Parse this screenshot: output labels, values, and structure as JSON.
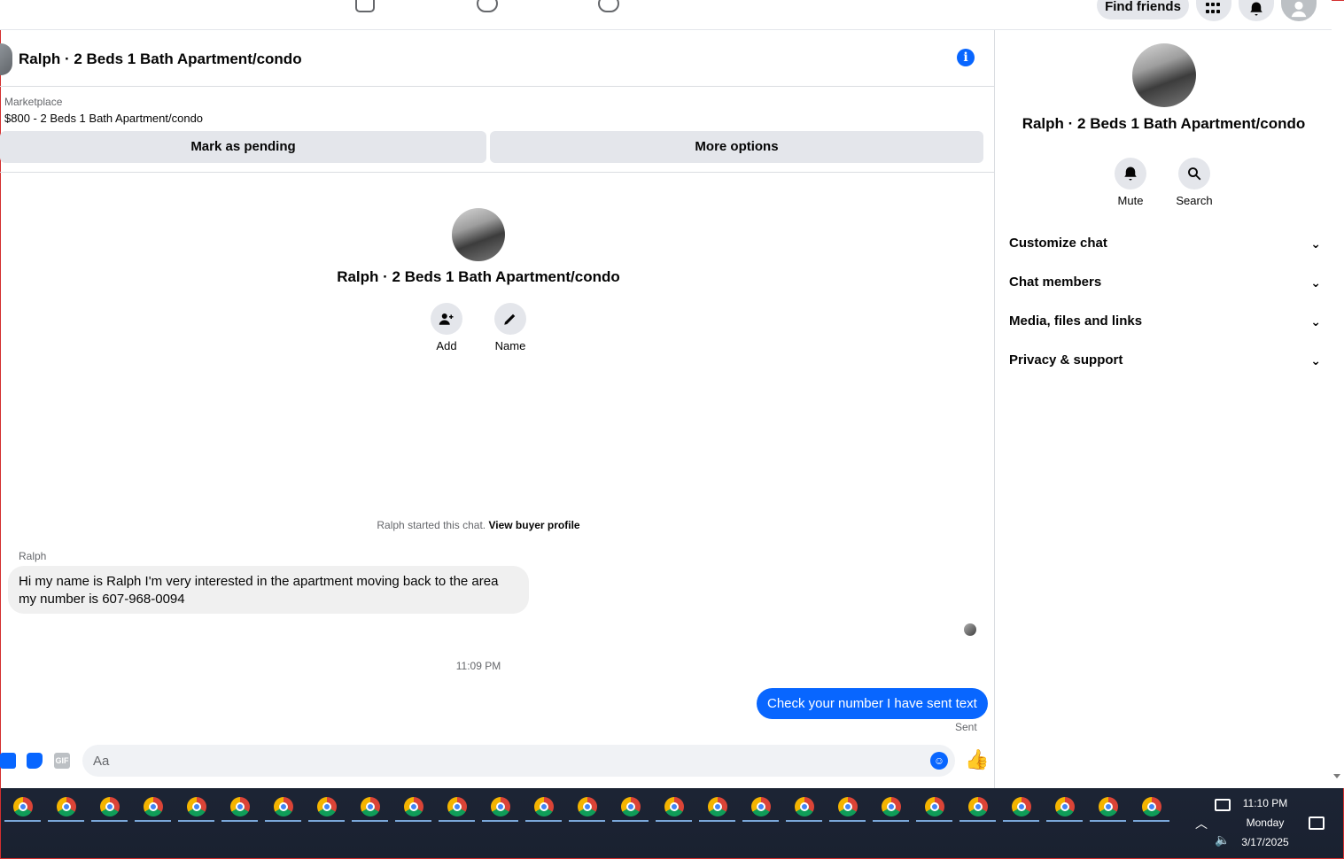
{
  "topnav": {
    "find_friends": "Find friends"
  },
  "chat": {
    "title": "Ralph · 2 Beds 1 Bath Apartment/condo",
    "marketplace_label": "Marketplace",
    "listing": "$800 - 2 Beds 1 Bath Apartment/condo",
    "mark_pending": "Mark as pending",
    "more_options": "More options",
    "profile_title": "Ralph · 2 Beds 1 Bath Apartment/condo",
    "actions": [
      {
        "label": "Add",
        "icon": "add-person-icon"
      },
      {
        "label": "Name",
        "icon": "pencil-icon"
      }
    ],
    "started_text": "Ralph started this chat.",
    "view_buyer_profile": "View buyer profile",
    "messages": [
      {
        "sender": "Ralph",
        "text": "Hi my name is Ralph I'm very interested in the apartment moving back to the area my number is 607-968-0094",
        "direction": "in"
      },
      {
        "timestamp": "11:09 PM"
      },
      {
        "text": "Check your number I have sent text",
        "direction": "out",
        "status": "Sent"
      }
    ],
    "composer_placeholder": "Aa",
    "gif_label": "GIF"
  },
  "right_panel": {
    "title": "Ralph · 2 Beds 1 Bath Apartment/condo",
    "actions": [
      {
        "label": "Mute",
        "icon": "bell-icon"
      },
      {
        "label": "Search",
        "icon": "search-icon"
      }
    ],
    "sections": [
      "Customize chat",
      "Chat members",
      "Media, files and links",
      "Privacy & support"
    ]
  },
  "taskbar": {
    "app_count": 27,
    "time": "11:10 PM",
    "day": "Monday",
    "date": "3/17/2025"
  },
  "colors": {
    "accent": "#0866ff",
    "button_bg": "#e4e6eb",
    "bubble_in": "#f0f0f0",
    "taskbar": "#1c2434"
  }
}
